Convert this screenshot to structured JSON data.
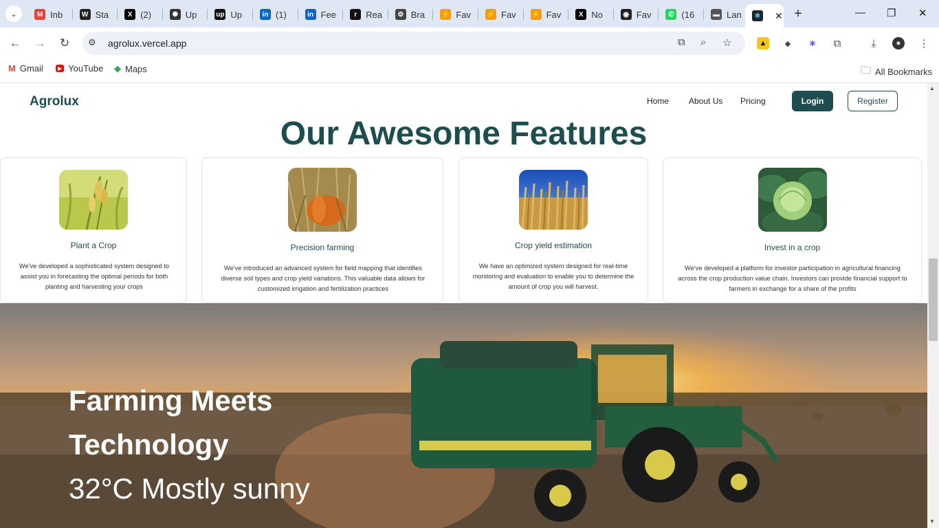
{
  "browser": {
    "tabs": [
      {
        "label": "Inb",
        "icon": "gmail-icon",
        "color": "#ea4335",
        "glyph": "M"
      },
      {
        "label": "Sta",
        "icon": "wiki-icon",
        "color": "#222222",
        "glyph": "W"
      },
      {
        "label": "(2)",
        "icon": "x-icon",
        "color": "#000000",
        "glyph": "X"
      },
      {
        "label": "Up",
        "icon": "openai-icon",
        "color": "#333333",
        "glyph": "✺"
      },
      {
        "label": "Up",
        "icon": "upwork-icon",
        "color": "#111111",
        "glyph": "up"
      },
      {
        "label": "(1)",
        "icon": "linkedin-icon",
        "color": "#0a66c2",
        "glyph": "in"
      },
      {
        "label": "Fee",
        "icon": "linkedin-icon",
        "color": "#0a66c2",
        "glyph": "in"
      },
      {
        "label": "Rea",
        "icon": "render-icon",
        "color": "#111111",
        "glyph": "r"
      },
      {
        "label": "Bra",
        "icon": "gear-icon",
        "color": "#444444",
        "glyph": "⚙"
      },
      {
        "label": "Fav",
        "icon": "bolt-icon",
        "color": "#f59e0b",
        "glyph": "⚡"
      },
      {
        "label": "Fav",
        "icon": "bolt-icon",
        "color": "#f59e0b",
        "glyph": "⚡"
      },
      {
        "label": "Fav",
        "icon": "bolt-icon",
        "color": "#f59e0b",
        "glyph": "⚡"
      },
      {
        "label": "No",
        "icon": "x-icon",
        "color": "#000000",
        "glyph": "X"
      },
      {
        "label": "Fav",
        "icon": "github-icon",
        "color": "#222222",
        "glyph": "◉"
      },
      {
        "label": "(16",
        "icon": "whatsapp-icon",
        "color": "#25d366",
        "glyph": "✆"
      },
      {
        "label": "Lan",
        "icon": "site-icon",
        "color": "#555555",
        "glyph": "▬"
      }
    ],
    "url": "agrolux.vercel.app",
    "bookmarks": [
      {
        "label": "Gmail",
        "icon": "gmail-icon"
      },
      {
        "label": "YouTube",
        "icon": "youtube-icon"
      },
      {
        "label": "Maps",
        "icon": "maps-icon"
      }
    ],
    "all_bookmarks": "All Bookmarks"
  },
  "site": {
    "logo": "Agrolux",
    "nav": {
      "home": "Home",
      "about": "About Us",
      "pricing": "Pricing"
    },
    "login": "Login",
    "register": "Register",
    "features_title": "Our Awesome Features",
    "features": [
      {
        "title": "Plant a Crop",
        "description": "We've developed a sophisticated system designed to assist you in forecasting the optimal periods for both planting and harvesting your crops",
        "image": "rice-plant-image"
      },
      {
        "title": "Precision farming",
        "description": "We've introduced an advanced system for field mapping that identifies diverse soil types and crop yield variations. This valuable data allows for customized irrigation and fertilization practices",
        "image": "pumpkin-field-image"
      },
      {
        "title": "Crop yield estimation",
        "description": "We have an optimized system designed for real-time monitoring and evaluation to enable you to determine the amount of crop you will harvest.",
        "image": "wheat-field-image"
      },
      {
        "title": "Invest in a crop",
        "description": "We've developed a platform for investor participation in agricultural financing across the crop production value chain. Investors can provide financial support to farmers in exchange for a share of the profits",
        "image": "cabbage-image"
      }
    ],
    "hero": {
      "line1": "Farming Meets",
      "line2": "Technology",
      "weather": "32°C Mostly sunny"
    }
  }
}
